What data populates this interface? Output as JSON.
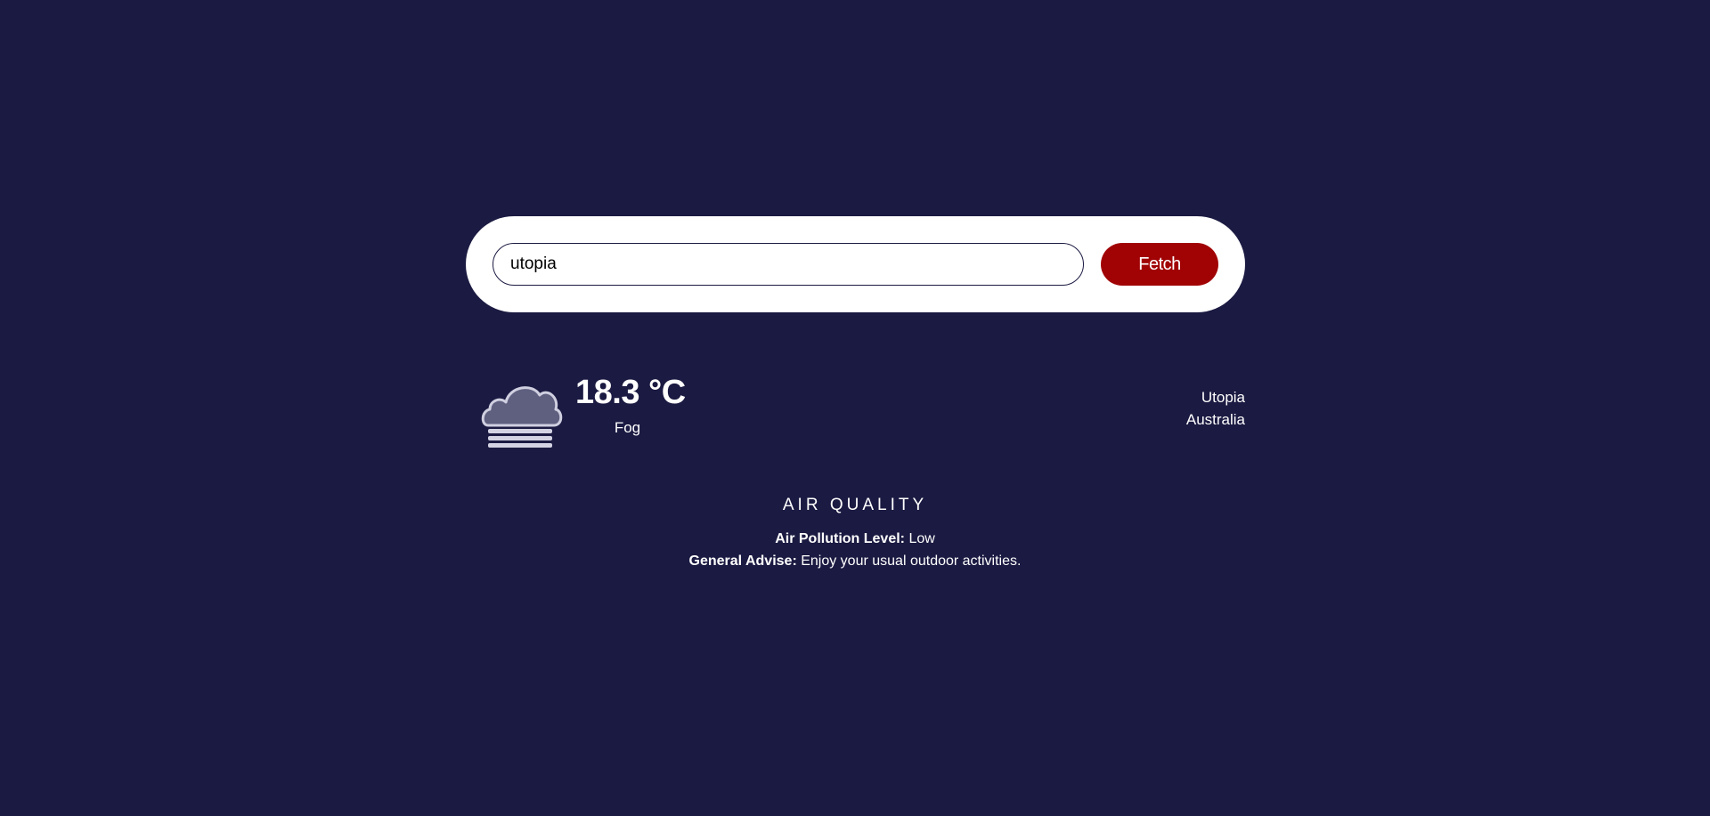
{
  "search": {
    "value": "utopia",
    "button_label": "Fetch"
  },
  "weather": {
    "temperature": "18.3 °C",
    "condition": "Fog",
    "icon": "fog-cloud-icon"
  },
  "location": {
    "city": "Utopia",
    "country": "Australia"
  },
  "air_quality": {
    "heading": "AIR QUALITY",
    "level_label": "Air Pollution Level:",
    "level_value": " Low",
    "advise_label": "General Advise:",
    "advise_value": " Enjoy your usual outdoor activities."
  },
  "colors": {
    "background": "#1b1a42",
    "accent": "#a10305",
    "card": "#ffffff"
  }
}
